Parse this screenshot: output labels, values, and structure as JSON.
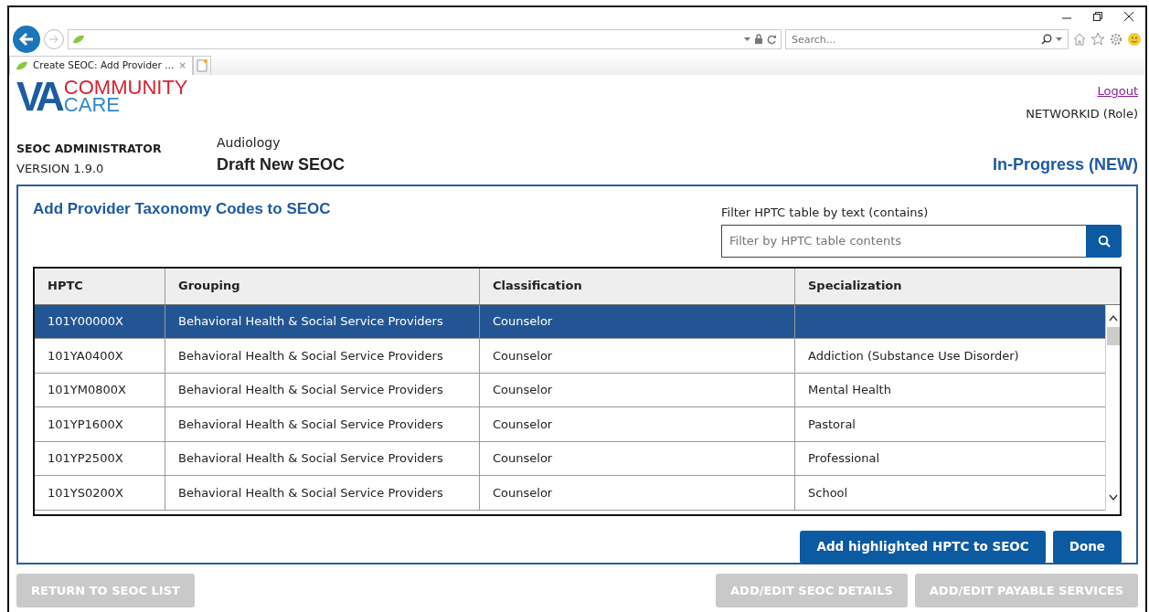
{
  "browser": {
    "search_placeholder": "Search...",
    "tab_title": "Create SEOC: Add Provider ...",
    "tab_close": "×"
  },
  "logo": {
    "initials": "VA",
    "top_word": "COMMUNITY",
    "bottom_word": "CARE"
  },
  "header": {
    "logout": "Logout",
    "user": "NETWORKID (Role)",
    "app_name": "SEOC ADMINISTRATOR",
    "version": "VERSION 1.9.0",
    "category": "Audiology",
    "title": "Draft New SEOC",
    "status": "In-Progress (NEW)"
  },
  "panel": {
    "title": "Add Provider Taxonomy Codes to SEOC",
    "filter_label": "Filter HPTC table by text (contains)",
    "filter_placeholder": "Filter by HPTC table contents",
    "table": {
      "columns": [
        "HPTC",
        "Grouping",
        "Classification",
        "Specialization"
      ],
      "rows": [
        {
          "cells": [
            "101Y00000X",
            "Behavioral Health & Social Service Providers",
            "Counselor",
            ""
          ],
          "selected": true
        },
        {
          "cells": [
            "101YA0400X",
            "Behavioral Health & Social Service Providers",
            "Counselor",
            "Addiction (Substance Use Disorder)"
          ],
          "selected": false
        },
        {
          "cells": [
            "101YM0800X",
            "Behavioral Health & Social Service Providers",
            "Counselor",
            "Mental Health"
          ],
          "selected": false
        },
        {
          "cells": [
            "101YP1600X",
            "Behavioral Health & Social Service Providers",
            "Counselor",
            "Pastoral"
          ],
          "selected": false
        },
        {
          "cells": [
            "101YP2500X",
            "Behavioral Health & Social Service Providers",
            "Counselor",
            "Professional"
          ],
          "selected": false
        },
        {
          "cells": [
            "101YS0200X",
            "Behavioral Health & Social Service Providers",
            "Counselor",
            "School"
          ],
          "selected": false
        }
      ]
    },
    "buttons": [
      {
        "label": "Add highlighted HPTC to SEOC",
        "disabled": false
      },
      {
        "label": "Done",
        "disabled": false
      }
    ]
  },
  "footer": {
    "left_buttons": [
      {
        "label": "RETURN TO SEOC LIST",
        "disabled": true
      }
    ],
    "right_buttons": [
      {
        "label": "ADD/EDIT SEOC DETAILS",
        "disabled": true
      },
      {
        "label": "ADD/EDIT PAYABLE SERVICES",
        "disabled": true
      }
    ]
  }
}
